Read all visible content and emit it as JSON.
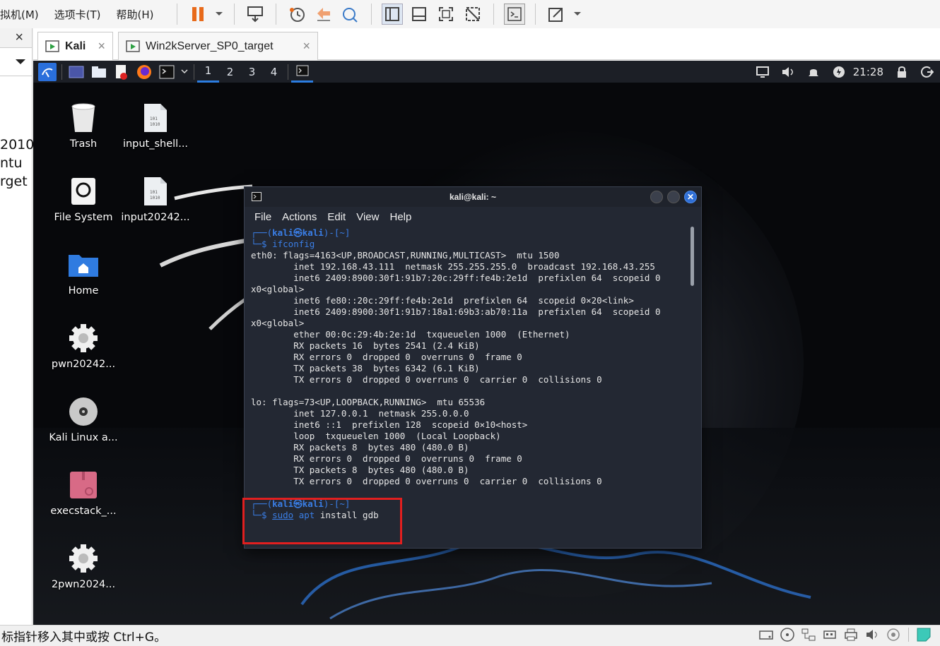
{
  "menubar": {
    "items": [
      "拟机(M)",
      "选项卡(T)",
      "帮助(H)"
    ]
  },
  "left_panel": {
    "close": "×",
    "snippets": [
      "2010",
      "ntu",
      "rget"
    ]
  },
  "vm_tabs": [
    {
      "label": "Kali",
      "close": "×"
    },
    {
      "label": "Win2kServer_SP0_target",
      "close": "×"
    }
  ],
  "panel": {
    "workspaces": [
      "1",
      "2",
      "3",
      "4"
    ],
    "clock": "21:28"
  },
  "desktop": {
    "icons": [
      {
        "label": "Trash"
      },
      {
        "label": "input_shell..."
      },
      {
        "label": "File System"
      },
      {
        "label": "input20242..."
      },
      {
        "label": "Home"
      },
      {
        "label": "pwn20242..."
      },
      {
        "label": "Kali Linux a..."
      },
      {
        "label": "execstack_..."
      },
      {
        "label": "2pwn2024..."
      }
    ]
  },
  "terminal": {
    "title": "kali@kali: ~",
    "menu": [
      "File",
      "Actions",
      "Edit",
      "View",
      "Help"
    ],
    "prompt_open": "┌──(",
    "prompt_user": "kali㉿kali",
    "prompt_close": ")-[~]",
    "prompt_dir": "~",
    "prompt_second": "└─$ ",
    "cmd1": "ifconfig",
    "output": [
      "eth0: flags=4163<UP,BROADCAST,RUNNING,MULTICAST>  mtu 1500",
      "        inet 192.168.43.111  netmask 255.255.255.0  broadcast 192.168.43.255",
      "        inet6 2409:8900:30f1:91b7:20c:29ff:fe4b:2e1d  prefixlen 64  scopeid 0",
      "x0<global>",
      "        inet6 fe80::20c:29ff:fe4b:2e1d  prefixlen 64  scopeid 0×20<link>",
      "        inet6 2409:8900:30f1:91b7:18a1:69b3:ab70:11a  prefixlen 64  scopeid 0",
      "x0<global>",
      "        ether 00:0c:29:4b:2e:1d  txqueuelen 1000  (Ethernet)",
      "        RX packets 16  bytes 2541 (2.4 KiB)",
      "        RX errors 0  dropped 0  overruns 0  frame 0",
      "        TX packets 38  bytes 6342 (6.1 KiB)",
      "        TX errors 0  dropped 0 overruns 0  carrier 0  collisions 0",
      "",
      "lo: flags=73<UP,LOOPBACK,RUNNING>  mtu 65536",
      "        inet 127.0.0.1  netmask 255.0.0.0",
      "        inet6 ::1  prefixlen 128  scopeid 0×10<host>",
      "        loop  txqueuelen 1000  (Local Loopback)",
      "        RX packets 8  bytes 480 (480.0 B)",
      "        RX errors 0  dropped 0  overruns 0  frame 0",
      "        TX packets 8  bytes 480 (480.0 B)",
      "        TX errors 0  dropped 0 overruns 0  carrier 0  collisions 0"
    ],
    "cmd2_sudo": "sudo",
    "cmd2_apt": "apt",
    "cmd2_rest": " install gdb"
  },
  "status": {
    "text": "标指针移入其中或按 Ctrl+G。"
  },
  "colors": {
    "accent": "#2c7de0",
    "highlight": "#e11f1f",
    "pause": "#e86a1a"
  }
}
